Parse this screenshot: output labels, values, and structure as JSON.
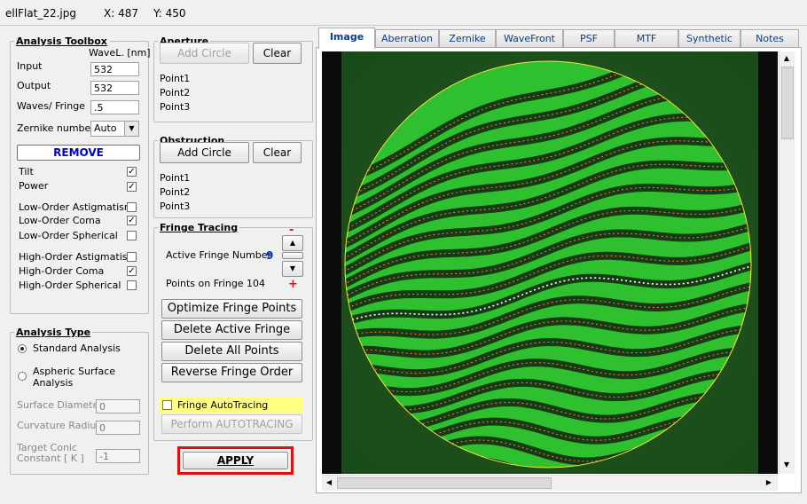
{
  "window": {
    "title": "ellFlat_22.jpg",
    "x_readout": "X: 487",
    "y_readout": "Y: 450"
  },
  "toolbox": {
    "title": "Analysis Toolbox",
    "wavel_label": "WaveL. [nm]",
    "input_label": "Input",
    "input_value": "532",
    "output_label": "Output",
    "output_value": "532",
    "wpf_label": "Waves/ Fringe",
    "wpf_value": ".5",
    "zernike_label": "Zernike number",
    "zernike_value": "Auto",
    "remove_label": "REMOVE",
    "terms": [
      {
        "label": "Tilt",
        "checked": true
      },
      {
        "label": "Power",
        "checked": true
      },
      {
        "label": "Low-Order  Astigmatism",
        "checked": false
      },
      {
        "label": "Low-Order  Coma",
        "checked": true
      },
      {
        "label": "Low-Order  Spherical",
        "checked": false
      },
      {
        "label": "High-Order  Astigmatism",
        "checked": false
      },
      {
        "label": "High-Order  Coma",
        "checked": true
      },
      {
        "label": "High-Order  Spherical",
        "checked": false
      }
    ]
  },
  "analysis_type": {
    "title": "Analysis Type",
    "standard_label": "Standard  Analysis",
    "aspheric_label1": "Aspheric  Surface",
    "aspheric_label2": "Analysis",
    "surface_diameter_label": "Surface Diameter",
    "surface_diameter_value": "0",
    "curvature_radius_label": "Curvature Radius",
    "curvature_radius_value": "0",
    "conic_label1": "Target Conic",
    "conic_label2": "Constant [ K ]",
    "conic_value": "-1"
  },
  "aperture": {
    "title": "Aperture",
    "add_label": "Add Circle",
    "clear_label": "Clear",
    "points": [
      "Point1",
      "Point2",
      "Point3"
    ]
  },
  "obstruction": {
    "title": "Obstruction",
    "add_label": "Add Circle",
    "clear_label": "Clear",
    "points": [
      "Point1",
      "Point2",
      "Point3"
    ]
  },
  "fringe": {
    "title": "Fringe Tracing",
    "active_label": "Active Fringe Number",
    "active_value": "9",
    "points_label": "Points on  Fringe 104",
    "minus": "-",
    "plus": "+",
    "optimize_label": "Optimize Fringe Points",
    "delete_active_label": "Delete Active Fringe",
    "delete_all_label": "Delete  All  Points",
    "reverse_label": "Reverse  Fringe Order",
    "autotracing_label": "Fringe AutoTracing",
    "perform_label": "Perform  AUTOTRACING"
  },
  "apply_label": "APPLY",
  "tabs": [
    "Image",
    "Aberration",
    "Zernike",
    "WaveFront",
    "PSF",
    "MTF",
    "Synthetic",
    "Notes"
  ],
  "active_tab": "Image",
  "colors": {
    "fringe_green": "#2fc02f",
    "dark_band": "#143014",
    "aperture_circle": "#ffe23a",
    "trace_points": "#ff7a3a",
    "active_trace": "#ffffff",
    "apply_border": "#e01010",
    "tab_text": "#0a3c8c",
    "remove_text": "#0000cc"
  }
}
